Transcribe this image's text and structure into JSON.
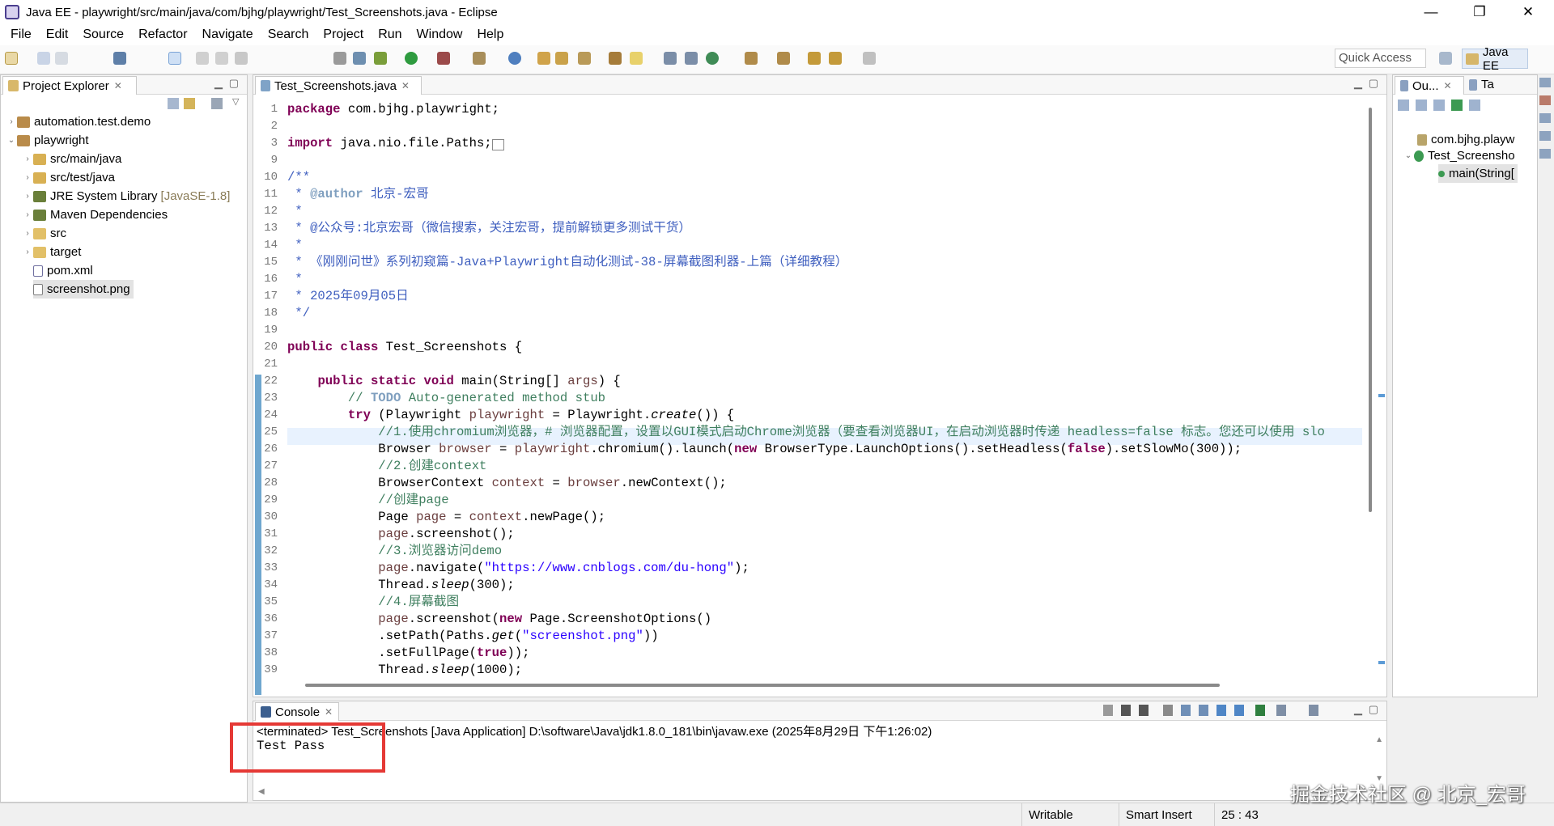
{
  "window": {
    "title": "Java EE - playwright/src/main/java/com/bjhg/playwright/Test_Screenshots.java - Eclipse",
    "minimize": "—",
    "maximize": "❐",
    "close": "✕"
  },
  "menu": [
    "File",
    "Edit",
    "Source",
    "Refactor",
    "Navigate",
    "Search",
    "Project",
    "Run",
    "Window",
    "Help"
  ],
  "toolbar": {
    "quick_access": "Quick Access",
    "perspective": "Java EE"
  },
  "project_explorer": {
    "title": "Project Explorer",
    "items": [
      {
        "label": "automation.test.demo",
        "extra": ""
      },
      {
        "label": "playwright",
        "extra": ""
      },
      {
        "label": "src/main/java",
        "extra": ""
      },
      {
        "label": "src/test/java",
        "extra": ""
      },
      {
        "label": "JRE System Library",
        "extra": "[JavaSE-1.8]"
      },
      {
        "label": "Maven Dependencies",
        "extra": ""
      },
      {
        "label": "src",
        "extra": ""
      },
      {
        "label": "target",
        "extra": ""
      },
      {
        "label": "pom.xml",
        "extra": ""
      },
      {
        "label": "screenshot.png",
        "extra": ""
      }
    ]
  },
  "editor": {
    "tab": "Test_Screenshots.java",
    "lines": [
      "1",
      "2",
      "3",
      "9",
      "10",
      "11",
      "12",
      "13",
      "14",
      "15",
      "16",
      "17",
      "18",
      "19",
      "20",
      "21",
      "22",
      "23",
      "24",
      "25",
      "26",
      "27",
      "28",
      "29",
      "30",
      "31",
      "32",
      "33",
      "34",
      "35",
      "36",
      "37",
      "38",
      "39"
    ]
  },
  "outline": {
    "tab1": "Ou...",
    "tab2": "Ta",
    "items": [
      "com.bjhg.playw",
      "Test_Screensho",
      "main(String["
    ]
  },
  "console": {
    "title": "Console",
    "status": "<terminated> Test_Screenshots [Java Application] D:\\software\\Java\\jdk1.8.0_181\\bin\\javaw.exe (2025年8月29日 下午1:26:02)",
    "output": "Test Pass"
  },
  "statusbar": {
    "mode": "Writable",
    "insert": "Smart Insert",
    "position": "25 : 43"
  },
  "watermark": "掘金技术社区 @ 北京_宏哥",
  "colors": {
    "keyword": "#7f0055",
    "javadoc": "#3f5fbf",
    "comment": "#3f7f5f",
    "string": "#2a00ff",
    "highlight": "#e8f2fe",
    "annotation_box": "#e53935"
  }
}
